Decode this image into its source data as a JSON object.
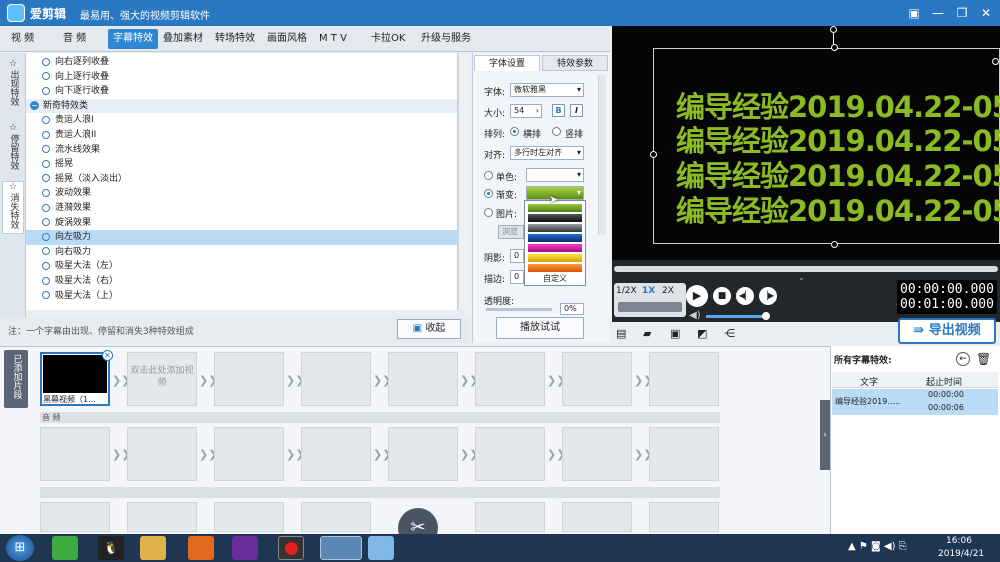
{
  "window": {
    "app_name": "爱剪辑",
    "slogan": "最易用、强大的视频剪辑软件"
  },
  "tabs": [
    "视 频",
    "音 频",
    "字幕特效",
    "叠加素材",
    "转场特效",
    "画面风格",
    "M T V",
    "卡拉OK",
    "升级与服务"
  ],
  "sidebar_tabs": [
    "出现特效",
    "停留特效",
    "消失特效"
  ],
  "effects_list": [
    {
      "label": "向右逐列收叠",
      "type": "item"
    },
    {
      "label": "向上逐行收叠",
      "type": "item"
    },
    {
      "label": "向下逐行收叠",
      "type": "item"
    },
    {
      "label": "新奇特效类",
      "type": "category"
    },
    {
      "label": "贵运人浪I",
      "type": "item"
    },
    {
      "label": "贵运人浪II",
      "type": "item"
    },
    {
      "label": "流水线效果",
      "type": "item"
    },
    {
      "label": "摇晃",
      "type": "item"
    },
    {
      "label": "摇晃（淡入淡出）",
      "type": "item"
    },
    {
      "label": "波动效果",
      "type": "item"
    },
    {
      "label": "涟漪效果",
      "type": "item"
    },
    {
      "label": "旋涡效果",
      "type": "item"
    },
    {
      "label": "向左吸力",
      "type": "item",
      "selected": true
    },
    {
      "label": "向右吸力",
      "type": "item"
    },
    {
      "label": "吸星大法（左）",
      "type": "item"
    },
    {
      "label": "吸星大法（右）",
      "type": "item"
    },
    {
      "label": "吸星大法（上）",
      "type": "item"
    }
  ],
  "note": "注：一个字幕由出现、停留和消失3种特效组成",
  "collapse_label": "收起",
  "play_test_label": "播放试试",
  "font_settings": {
    "tab_font": "字体设置",
    "tab_params": "特效参数",
    "font_label": "字体:",
    "font_value": "微软雅黑",
    "size_label": "大小:",
    "size_value": "54",
    "bold": "B",
    "italic": "I",
    "arrange_label": "排列:",
    "arrange_h": "横排",
    "arrange_v": "竖排",
    "align_label": "对齐:",
    "align_value": "多行时左对齐",
    "solid_label": "单色:",
    "gradient_label": "渐变:",
    "image_label": "图片:",
    "browse_label": "浏览",
    "shadow_label": "阴影:",
    "shadow_value": "0",
    "stroke_label": "描边:",
    "stroke_value": "0",
    "opacity_label": "透明度:",
    "opacity_value": "0%",
    "custom_label": "自定义"
  },
  "preview": {
    "subtitle_lines": [
      "编导经验2019.04.22-05",
      "编导经验2019.04.22-05",
      "编导经验2019.04.22-05",
      "编导经验2019.04.22-05"
    ],
    "text_color": "#8bbb23"
  },
  "player": {
    "speeds": [
      "1/2X",
      "1X",
      "2X"
    ],
    "current_time": "00:00:00.000",
    "total_time": "00:01:00.000",
    "export_label": "导出视频"
  },
  "timeline": {
    "side_label": "已添加片段",
    "clip_label": "黑幕视频（1...",
    "add_hint": "双击此处添加视频",
    "audio_label": "音 频"
  },
  "fx_panel": {
    "title": "所有字幕特效:",
    "col_text": "文字",
    "col_time": "起止时间",
    "row_text": "编导经验2019.....",
    "row_start": "00:00:00",
    "row_end": "00:00:06"
  },
  "clock": {
    "time": "16:06",
    "date": "2019/4/21"
  }
}
